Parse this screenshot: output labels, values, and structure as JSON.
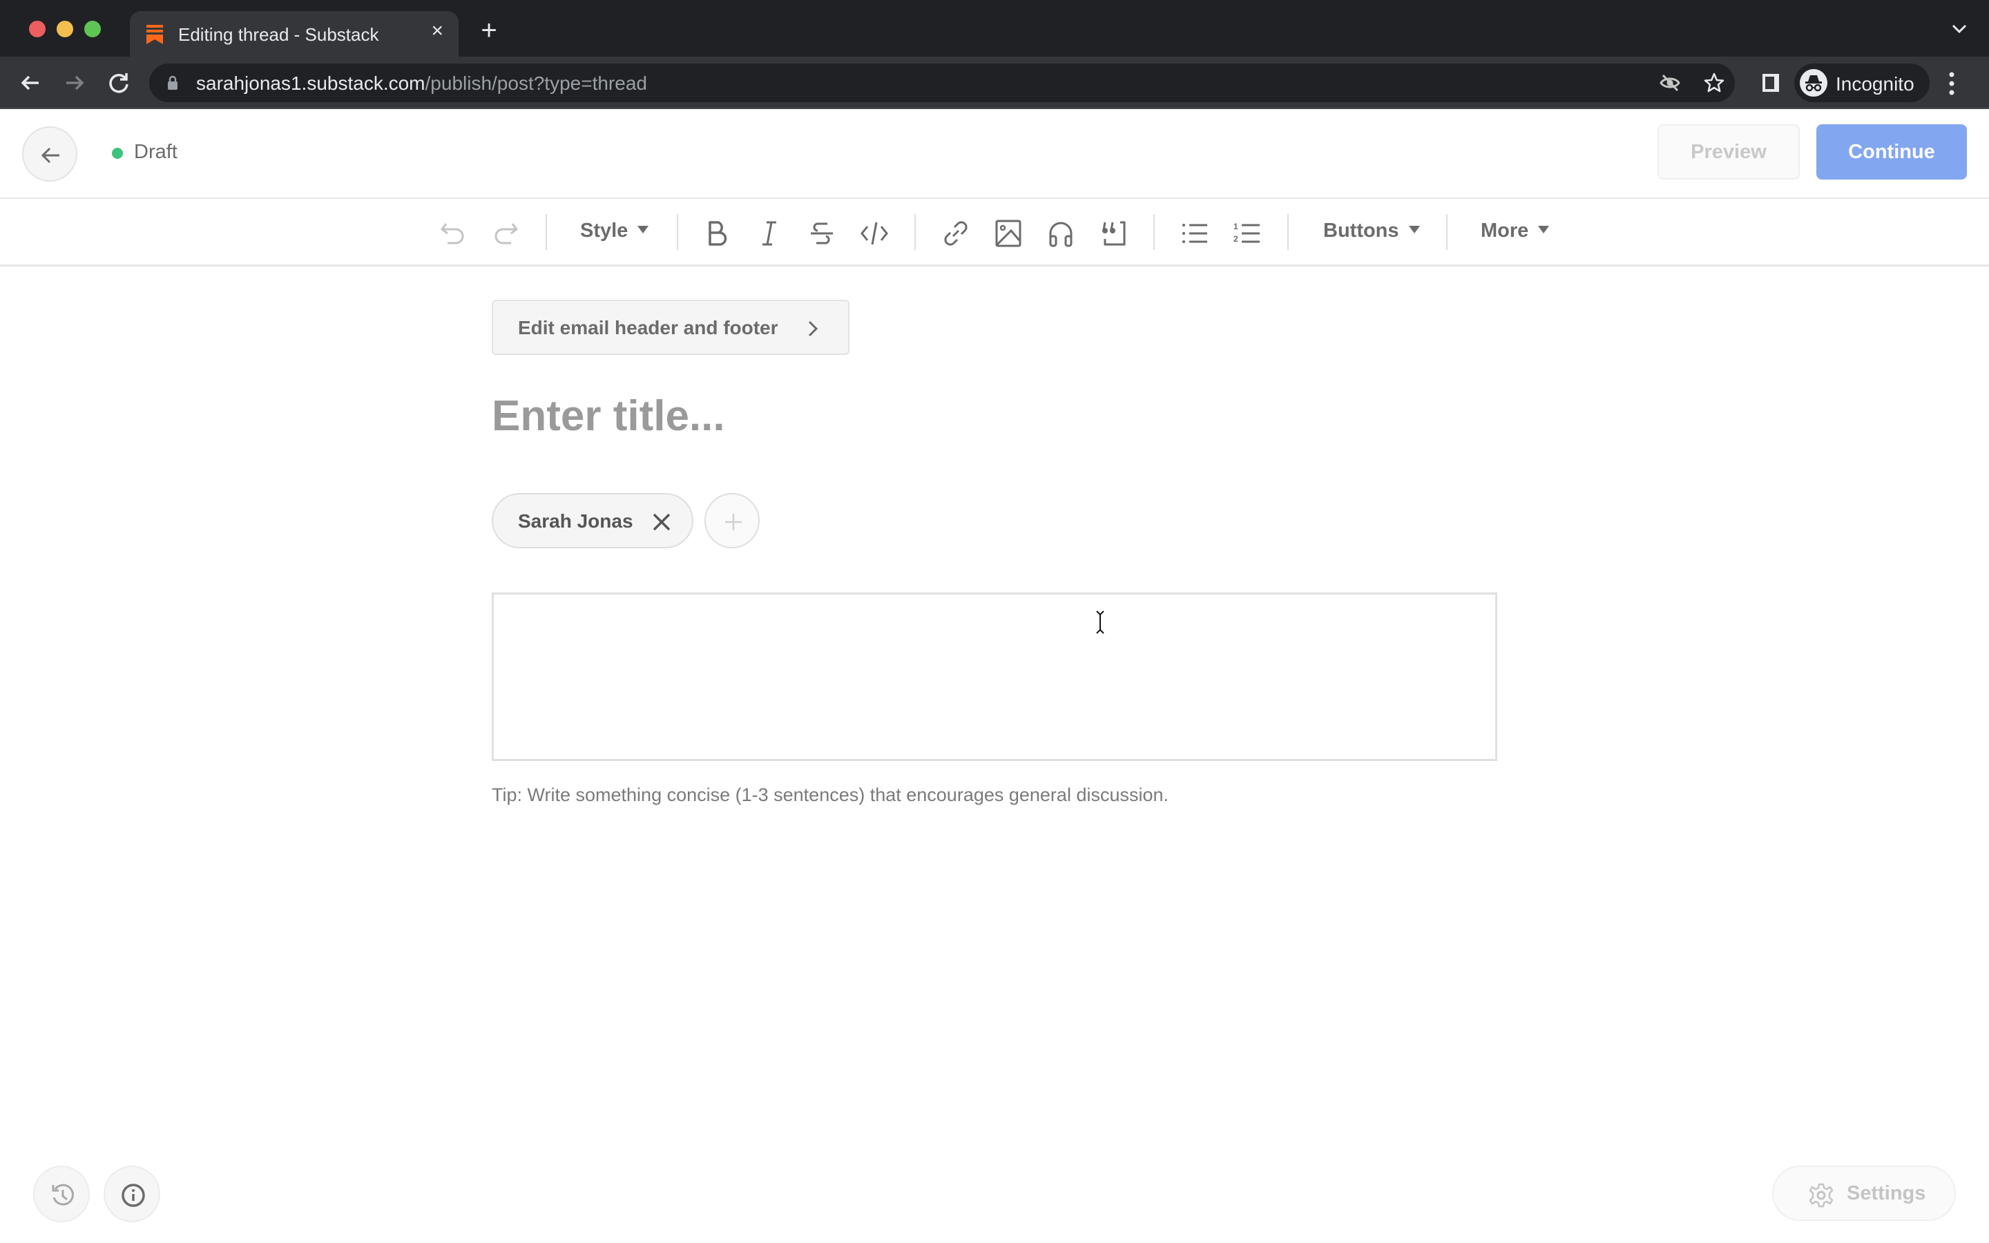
{
  "browser": {
    "tab_title": "Editing thread - Substack",
    "tab_close": "×",
    "new_tab": "+",
    "url_host": "sarahjonas1.substack.com",
    "url_path": "/publish/post?type=thread",
    "profile_label": "Incognito"
  },
  "header": {
    "status_label": "Draft",
    "status_color": "#3ec27f",
    "preview_label": "Preview",
    "continue_label": "Continue",
    "continue_color": "#82a6f0"
  },
  "toolbar": {
    "style_label": "Style",
    "buttons_label": "Buttons",
    "more_label": "More",
    "icons": [
      "undo-icon",
      "redo-icon",
      "bold-icon",
      "italic-icon",
      "strikethrough-icon",
      "code-icon",
      "link-icon",
      "image-icon",
      "audio-icon",
      "quote-icon",
      "bullet-list-icon",
      "numbered-list-icon"
    ]
  },
  "editor": {
    "email_header_footer_label": "Edit email header and footer",
    "title_placeholder": "Enter title...",
    "title_value": "",
    "authors": [
      {
        "name": "Sarah Jonas"
      }
    ],
    "body_value": "",
    "tip": "Tip: Write something concise (1-3 sentences) that encourages general discussion."
  },
  "footer": {
    "settings_label": "Settings"
  }
}
